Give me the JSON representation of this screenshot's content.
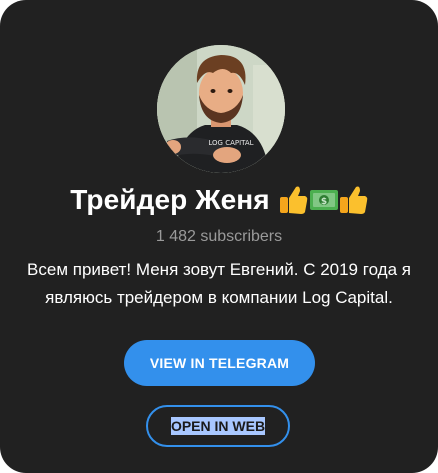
{
  "channel": {
    "name": "Трейдер Женя",
    "emoji_icons": [
      "thumbs-up-emoji",
      "dollar-banknote-emoji",
      "thumbs-up-emoji"
    ],
    "subscribers": "1 482 subscribers",
    "description_line1": "Всем привет! Меня зовут Евгений. С 2019 года я",
    "description_line2": "являюсь трейдером в компании Log Capital.",
    "avatar_shirt_text": "LOG CAPITAL"
  },
  "buttons": {
    "view_label": "VIEW IN TELEGRAM",
    "web_label": "OPEN IN WEB"
  },
  "colors": {
    "background": "#212121",
    "accent": "#3390ec",
    "secondary_text": "#9a9a9a",
    "selection": "#a8c7ff"
  }
}
